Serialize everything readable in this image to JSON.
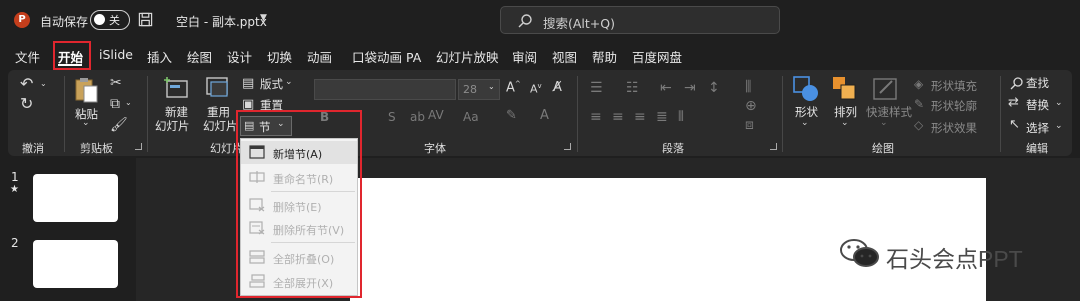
{
  "titlebar": {
    "app_icon": "P",
    "autosave_label": "自动保存",
    "autosave_state": "关",
    "doc_title": "空白 - 副本.pptx",
    "search_placeholder": "搜索(Alt+Q)"
  },
  "tabs": [
    "文件",
    "开始",
    "iSlide",
    "插入",
    "绘图",
    "设计",
    "切换",
    "动画",
    "口袋动画 PA",
    "幻灯片放映",
    "审阅",
    "视图",
    "帮助",
    "百度网盘"
  ],
  "active_tab": "开始",
  "ribbon": {
    "undo_group": {
      "label": "撤消"
    },
    "clipboard_group": {
      "label": "剪贴板",
      "paste": "粘贴"
    },
    "slides_group": {
      "label": "幻灯片",
      "new_slide": [
        "新建",
        "幻灯片"
      ],
      "reuse_slide": [
        "重用",
        "幻灯片"
      ],
      "layout": "版式",
      "reset": "重置",
      "section": "节"
    },
    "font_group": {
      "label": "字体",
      "font_size": "28"
    },
    "paragraph_group": {
      "label": "段落"
    },
    "drawing_group": {
      "label": "绘图",
      "shapes": "形状",
      "arrange": "排列",
      "quick_styles": "快速样式",
      "shape_fill": "形状填充",
      "shape_outline": "形状轮廓",
      "shape_effects": "形状效果"
    },
    "editing_group": {
      "label": "编辑",
      "find": "查找",
      "replace": "替换",
      "select": "选择"
    }
  },
  "section_menu": {
    "items": [
      {
        "label": "新增节(A)",
        "enabled": true
      },
      {
        "label": "重命名节(R)",
        "enabled": false
      },
      {
        "label": "删除节(E)",
        "enabled": false
      },
      {
        "label": "删除所有节(V)",
        "enabled": false
      },
      {
        "label": "全部折叠(O)",
        "enabled": false
      },
      {
        "label": "全部展开(X)",
        "enabled": false
      }
    ]
  },
  "slides_panel": {
    "slide_numbers": [
      "1",
      "2"
    ],
    "star": "★"
  },
  "watermark": "石头会点PPT",
  "colors": {
    "highlight": "#e0262e",
    "ppt_brand": "#c43e1c"
  }
}
